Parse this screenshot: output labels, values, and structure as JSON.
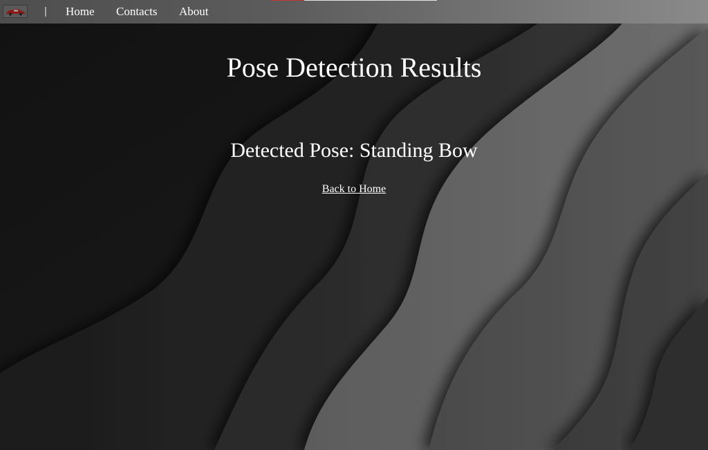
{
  "nav": {
    "logo_icon": "car-logo-icon",
    "divider": "|",
    "home_label": "Home",
    "contacts_label": "Contacts",
    "about_label": "About"
  },
  "main": {
    "title": "Pose Detection Results",
    "result": "Detected Pose: Standing Bow",
    "back_link": "Back to Home"
  },
  "colors": {
    "text": "#ffffff",
    "nav_accent": "#c0392b"
  }
}
